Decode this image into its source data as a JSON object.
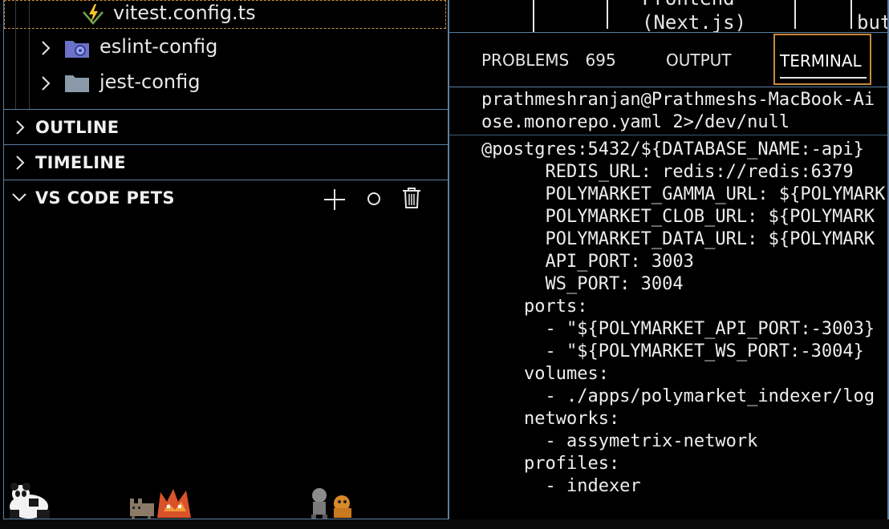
{
  "explorer": {
    "current_file": "vitest.config.ts",
    "folders": [
      {
        "label": "eslint-config",
        "icon": "gear-folder-icon"
      },
      {
        "label": "jest-config",
        "icon": "folder-icon"
      }
    ]
  },
  "sections": {
    "outline": "OUTLINE",
    "timeline": "TIMELINE",
    "pets": "VS CODE PETS"
  },
  "pets_actions": {
    "add_icon": "plus-icon",
    "ball_icon": "circle-icon",
    "delete_icon": "trash-icon"
  },
  "top_strip": {
    "box1_line1": "Frontend",
    "box1_line2": "(Next.js)",
    "box2_line2": "but"
  },
  "panel_tabs": {
    "problems": "PROBLEMS",
    "problems_count": "695",
    "output": "OUTPUT",
    "terminal": "TERMINAL"
  },
  "terminal": {
    "prompt_line1": "prathmeshranjan@Prathmeshs-MacBook-Ai",
    "prompt_line2": "ose.monorepo.yaml 2>/dev/null",
    "lines": [
      "@postgres:5432/${DATABASE_NAME:-api}",
      "      REDIS_URL: redis://redis:6379",
      "      POLYMARKET_GAMMA_URL: ${POLYMARK",
      "      POLYMARKET_CLOB_URL: ${POLYMARK",
      "      POLYMARKET_DATA_URL: ${POLYMARK",
      "      API_PORT: 3003",
      "      WS_PORT: 3004",
      "    ports:",
      "      - \"${POLYMARKET_API_PORT:-3003}",
      "      - \"${POLYMARKET_WS_PORT:-3004}",
      "    volumes:",
      "      - ./apps/polymarket_indexer/log",
      "    networks:",
      "      - assymetrix-network",
      "    profiles:",
      "      - indexer"
    ]
  },
  "colors": {
    "accent_border": "#c98a3a",
    "divider": "#5a7fa0",
    "background": "#000000"
  }
}
